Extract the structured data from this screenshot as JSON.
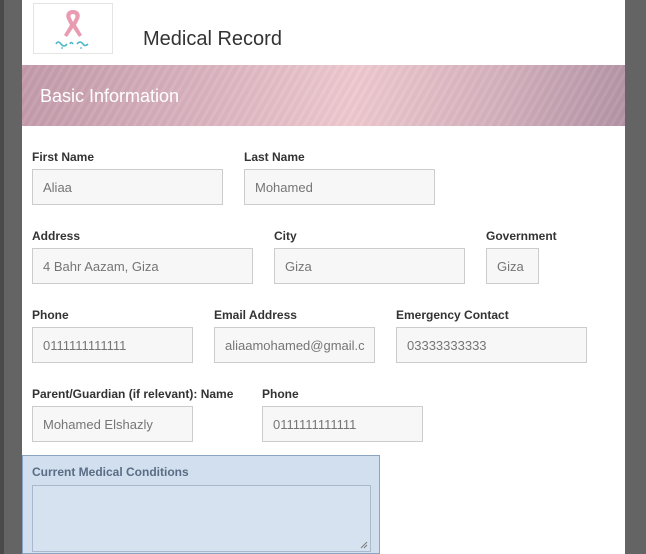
{
  "header": {
    "title": "Medical Record",
    "logo_icon": "pink-ribbon-logo"
  },
  "section": {
    "title": "Basic Information"
  },
  "fields": {
    "first_name": {
      "label": "First Name",
      "placeholder": "Aliaa"
    },
    "last_name": {
      "label": "Last Name",
      "placeholder": "Mohamed"
    },
    "address": {
      "label": "Address",
      "placeholder": "4 Bahr Aazam, Giza"
    },
    "city": {
      "label": "City",
      "placeholder": "Giza"
    },
    "government": {
      "label": "Government",
      "placeholder": "Giza"
    },
    "phone": {
      "label": "Phone",
      "placeholder": "0111111111111"
    },
    "email": {
      "label": "Email Address",
      "placeholder": "aliaamohamed@gmail.c"
    },
    "emergency": {
      "label": "Emergency Contact",
      "placeholder": "03333333333"
    },
    "guardian_name": {
      "label": "Parent/Guardian (if relevant): Name",
      "placeholder": "Mohamed Elshazly"
    },
    "guardian_phone": {
      "label": "Phone",
      "placeholder": "0111111111111"
    }
  },
  "conditions": {
    "label": "Current Medical Conditions",
    "value": ""
  },
  "colors": {
    "page_bg": "#646464",
    "banner_accent": "#d9b3bf",
    "conditions_bg": "#d1dfee"
  }
}
